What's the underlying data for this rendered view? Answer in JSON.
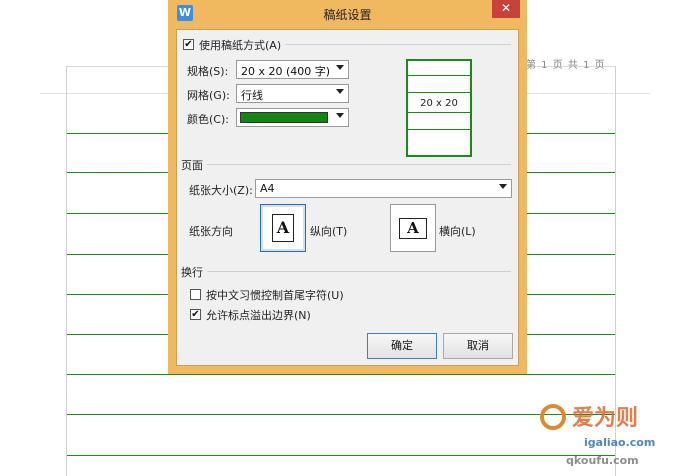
{
  "document": {
    "page_counter": "第 1 页 共 1 页"
  },
  "dialog": {
    "title": "稿纸设置",
    "app_icon": "W",
    "close_glyph": "✕",
    "use_manuscript": {
      "label": "使用稿纸方式(A)",
      "checked": true
    },
    "spec": {
      "label": "规格(S):",
      "value": "20 x 20 (400 字)"
    },
    "grid": {
      "label": "网格(G):",
      "value": "行线"
    },
    "color": {
      "label": "颜色(C):",
      "value_hex": "#128512"
    },
    "preview_label": "20 x 20",
    "page_section": {
      "header": "页面",
      "paper_size_label": "纸张大小(Z):",
      "paper_size_value": "A4",
      "orientation_label": "纸张方向",
      "portrait": {
        "label": "纵向(T)",
        "glyph": "A",
        "selected": true
      },
      "landscape": {
        "label": "横向(L)",
        "glyph": "A",
        "selected": false
      }
    },
    "wrap_section": {
      "header": "换行",
      "option1": {
        "label": "按中文习惯控制首尾字符(U)",
        "checked": false
      },
      "option2": {
        "label": "允许标点溢出边界(N)",
        "checked": true
      }
    },
    "ok_label": "确定",
    "cancel_label": "取消"
  },
  "watermark": {
    "line1": "爱为则",
    "line2": "igaliao.com",
    "line3": "qkoufu.com"
  }
}
